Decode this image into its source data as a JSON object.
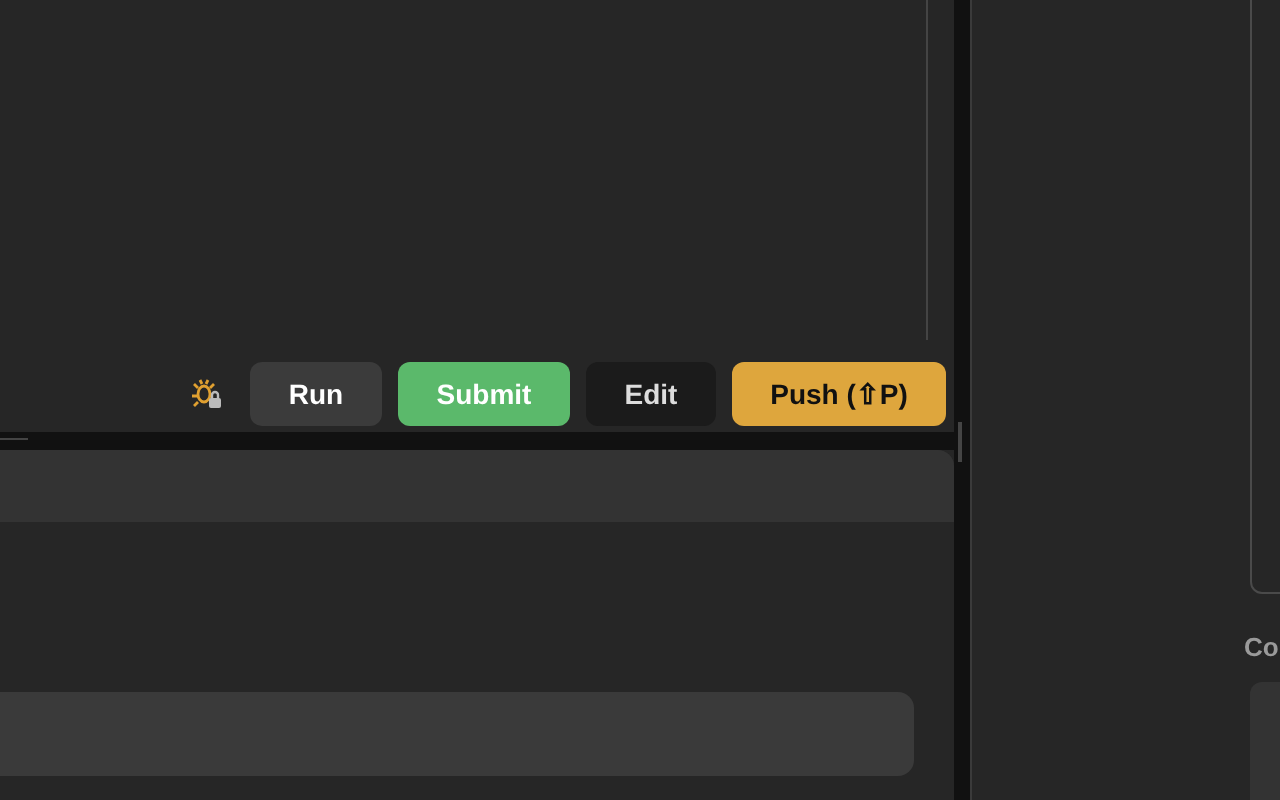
{
  "toolbar": {
    "buttons": [
      {
        "label": "Run",
        "kind": "secondary"
      },
      {
        "label": "Submit",
        "kind": "success"
      },
      {
        "label": "Edit",
        "kind": "dark"
      },
      {
        "label": "Push (⇧P)",
        "kind": "warning"
      }
    ]
  },
  "side_panel": {
    "section_label": "Co"
  }
}
